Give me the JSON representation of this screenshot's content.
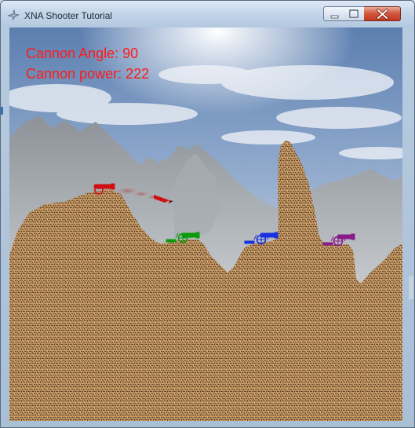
{
  "window": {
    "title": "XNA Shooter Tutorial",
    "icon": "app-icon",
    "controls": [
      "minimize-icon",
      "maximize-icon",
      "close-icon"
    ]
  },
  "hud": {
    "angle_label": "Cannon Angle: 90",
    "power_label": "Cannon power: 222",
    "color": "#ff1a1a"
  },
  "game": {
    "cannon_angle": 90,
    "cannon_power": 222,
    "players": [
      {
        "name": "red",
        "color": "#d01010",
        "active": true
      },
      {
        "name": "green",
        "color": "#0a9a0a",
        "active": false
      },
      {
        "name": "blue",
        "color": "#1830e0",
        "active": false
      },
      {
        "name": "purple",
        "color": "#8a1a8a",
        "active": false
      }
    ],
    "projectile": "rocket-icon"
  }
}
